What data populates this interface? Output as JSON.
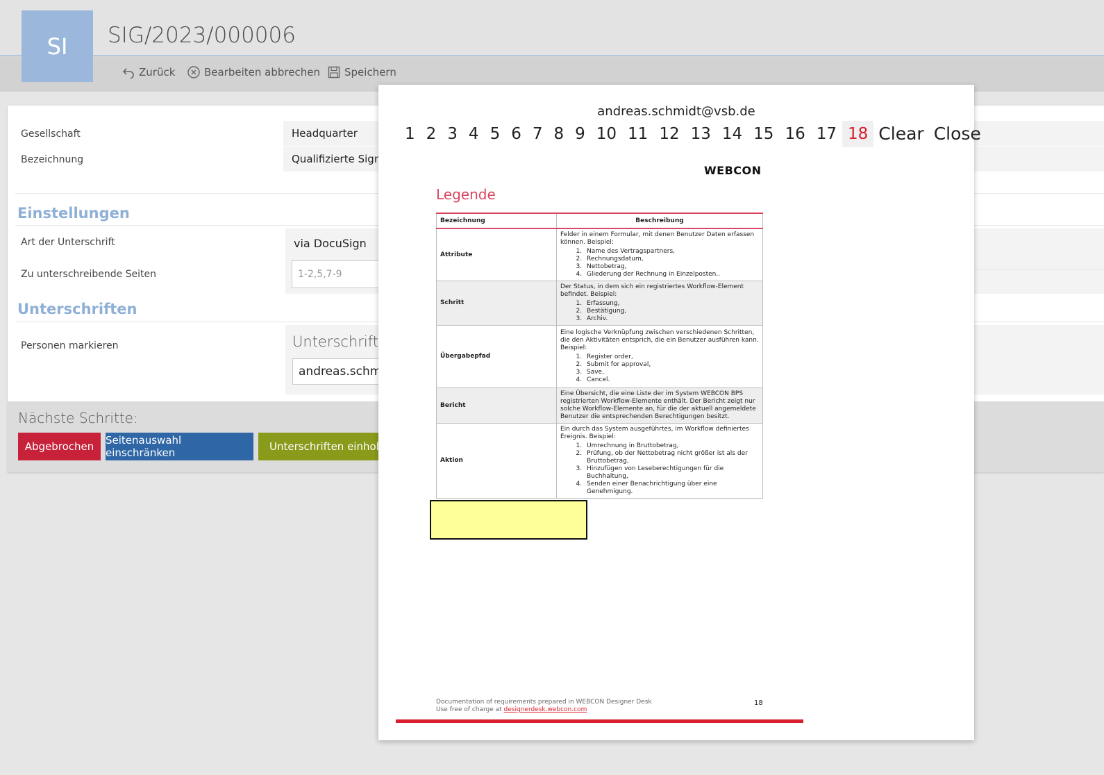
{
  "header": {
    "avatar_initials": "SI",
    "title": "SIG/2023/000006"
  },
  "toolbar": {
    "back_label": "Zurück",
    "cancel_edit_label": "Bearbeiten abbrechen",
    "save_label": "Speichern"
  },
  "form": {
    "company_label": "Gesellschaft",
    "company_value": "Headquarter",
    "name_label": "Bezeichnung",
    "name_value": "Qualifizierte Signa",
    "settings_title": "Einstellungen",
    "signature_type_label": "Art der Unterschrift",
    "signature_type_value": "via DocuSign",
    "pages_label": "Zu unterschreibende Seiten",
    "pages_placeholder": "1-2,5,7-9",
    "signatures_title": "Unterschriften",
    "mark_persons_label": "Personen markieren",
    "signature_column_header": "Unterschrift",
    "signature_person_value": "andreas.schmic"
  },
  "next_steps": {
    "title": "Nächste Schritte:",
    "buttons": [
      {
        "label": "Abgebrochen",
        "color": "#c8213a"
      },
      {
        "label": "Seitenauswahl einschränken",
        "color": "#2e66a6"
      },
      {
        "label": "Unterschriften einholen",
        "color": "#8a9a1b"
      }
    ]
  },
  "modal": {
    "email": "andreas.schmidt@vsb.de",
    "pages": [
      "1",
      "2",
      "3",
      "4",
      "5",
      "6",
      "7",
      "8",
      "9",
      "10",
      "11",
      "12",
      "13",
      "14",
      "15",
      "16",
      "17",
      "18"
    ],
    "active_page": "18",
    "clear_label": "Clear",
    "close_label": "Close"
  },
  "document": {
    "logo": "WEBCON",
    "heading": "Legende",
    "col_term": "Bezeichnung",
    "col_desc": "Beschreibung",
    "rows": [
      {
        "term": "Attribute",
        "intro": "Felder in einem Formular, mit denen Benutzer Daten erfassen können. Beispiel:",
        "items": [
          "Name des Vertragspartners,",
          "Rechnungsdatum,",
          "Nettobetrag,",
          "Gliederung der Rechnung in Einzelposten.."
        ]
      },
      {
        "term": "Schritt",
        "intro": "Der Status, in dem sich ein registriertes Workflow-Element befindet. Beispiel:",
        "items": [
          "Erfassung,",
          "Bestätigung,",
          "Archiv."
        ]
      },
      {
        "term": "Übergabepfad",
        "intro": "Eine logische Verknüpfung zwischen verschiedenen Schritten, die den Aktivitäten entsprich, die ein Benutzer ausführen kann. Beispiel:",
        "items": [
          "Register order,",
          "Submit for approval,",
          "Save,",
          "Cancel."
        ]
      },
      {
        "term": "Bericht",
        "intro": "Eine Übersicht, die eine Liste der im System WEBCON BPS registrierten Workflow-Elemente enthält. Der Bericht zeigt nur solche Workflow-Elemente an, für die der aktuell angemeldete Benutzer die entsprechenden Berechtigungen besitzt.",
        "items": []
      },
      {
        "term": "Aktion",
        "intro": "Ein durch das System ausgeführtes, im Workflow definiertes Ereignis. Beispiel:",
        "items": [
          "Umrechnung in Bruttobetrag,",
          "Prüfung, ob der Nettobetrag nicht größer ist als der Bruttobetrag,",
          "Hinzufügen von Leseberechtigungen für die Buchhaltung,",
          "Senden einer Benachrichtigung über eine Genehmigung."
        ]
      }
    ],
    "footer_line1": "Documentation of requirements prepared in WEBCON Designer Desk",
    "footer_line2_prefix": "Use free of charge at ",
    "footer_link": "designerdesk.webcon.com",
    "page_number": "18"
  }
}
